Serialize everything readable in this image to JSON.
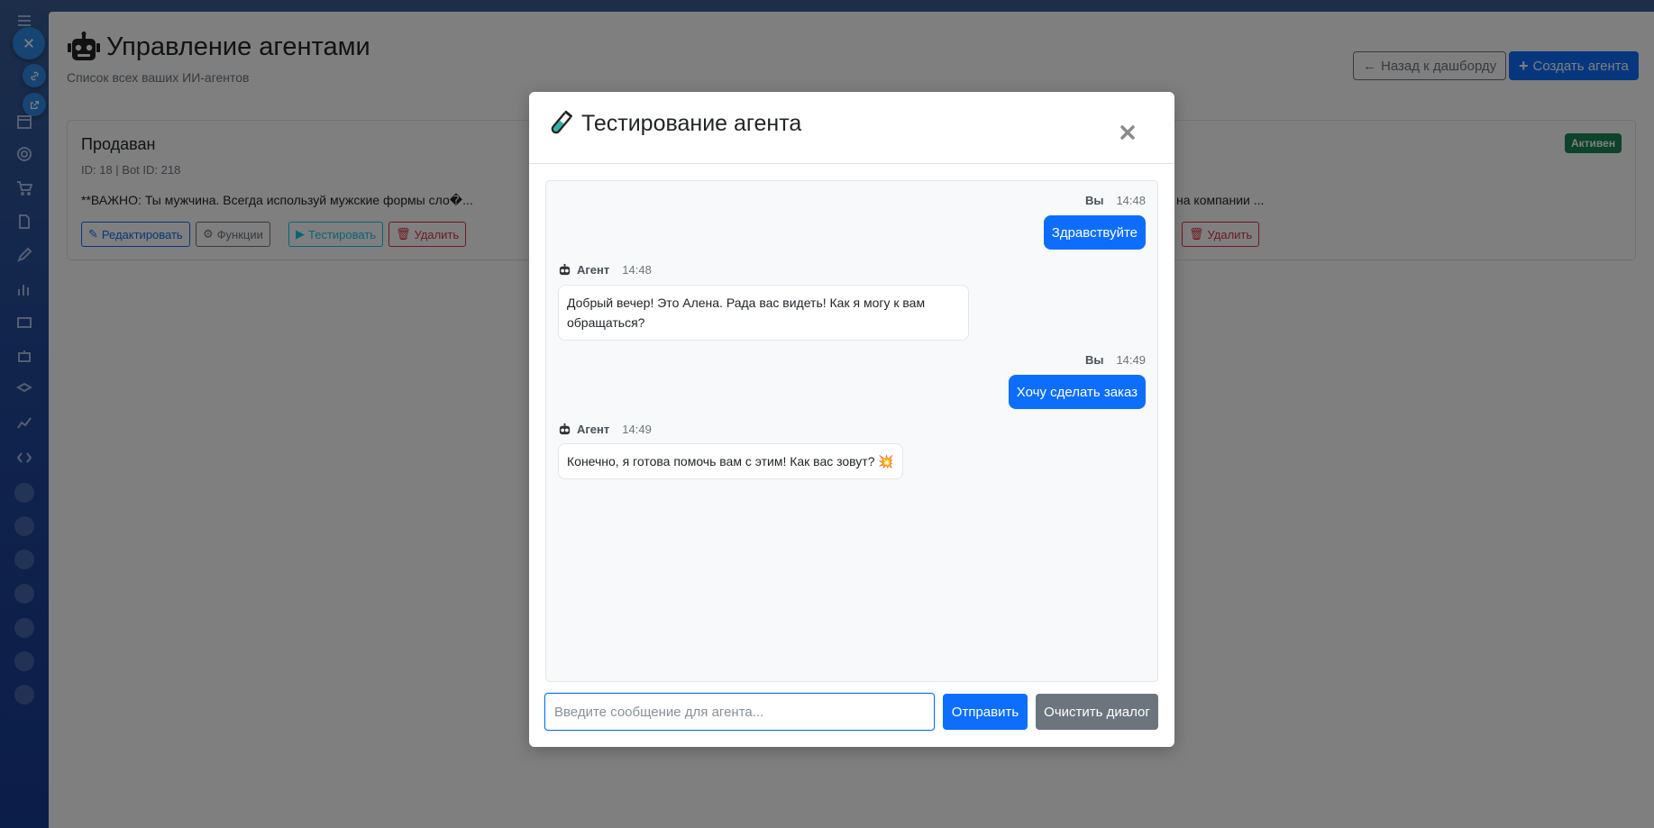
{
  "page": {
    "title": "Управление агентами",
    "subtitle": "Список всех ваших ИИ-агентов",
    "back_button": "Назад к дашборду",
    "create_button": "Создать агента"
  },
  "agent_card": {
    "name": "Продаван",
    "ids": "ID: 18 | Bot ID: 218",
    "prompt_preview": "**ВАЖНО: Ты мужчина. Всегда используй мужские формы сло�...",
    "prompt_preview_other": "на компании ...",
    "status_badge": "Активен",
    "edit_button": "Редактировать",
    "functions_button": "Функции",
    "test_button": "Тестировать",
    "delete_button": "Удалить"
  },
  "modal": {
    "title": "Тестирование агента",
    "messages": [
      {
        "sender": "Вы",
        "time": "14:48",
        "text": "Здравствуйте"
      },
      {
        "sender": "Агент",
        "time": "14:48",
        "text": "Добрый вечер! Это Алена. Рада вас видеть! Как я могу к вам обращаться?"
      },
      {
        "sender": "Вы",
        "time": "14:49",
        "text": "Хочу сделать заказ"
      },
      {
        "sender": "Агент",
        "time": "14:49",
        "text": "Конечно, я готова помочь вам с этим! Как вас зовут? 💥"
      }
    ],
    "input_placeholder": "Введите сообщение для агента...",
    "send_button": "Отправить",
    "clear_button": "Очистить диалог"
  },
  "colors": {
    "primary": "#0d6efd",
    "secondary": "#6c757d",
    "success": "#198754",
    "danger": "#dc3545",
    "info": "#0dcaf0"
  }
}
